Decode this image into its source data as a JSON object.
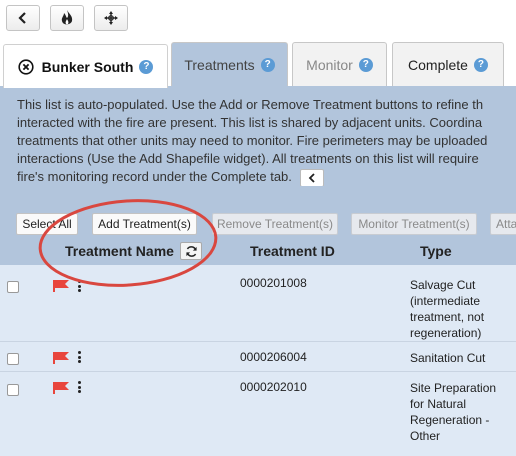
{
  "toolbar": {
    "buttons": [
      {
        "icon": "chevron-left-icon"
      },
      {
        "icon": "fire-icon"
      },
      {
        "icon": "move-crosshair-icon"
      }
    ]
  },
  "tabs": [
    {
      "label": "Bunker South",
      "icon": "close-circle-icon",
      "help": "?",
      "active": true
    },
    {
      "label": "Treatments",
      "help": "?"
    },
    {
      "label": "Monitor",
      "help": "?"
    },
    {
      "label": "Complete",
      "help": "?"
    }
  ],
  "description_lines": [
    "This list is auto-populated. Use the Add or Remove Treatment buttons to refine th",
    "interacted with the fire are present. This list is shared by adjacent units. Coordina",
    "treatments that other units may need to monitor. Fire perimeters may be uploaded",
    "interactions (Use the Add Shapefile widget). All treatments on this list will require",
    "fire's monitoring record under the Complete tab."
  ],
  "actions": {
    "select_all": "Select All",
    "add": "Add Treatment(s)",
    "remove": "Remove Treatment(s)",
    "monitor": "Monitor Treatment(s)",
    "attach": "Atta"
  },
  "table": {
    "headers": {
      "name": "Treatment Name",
      "id": "Treatment ID",
      "type": "Type"
    },
    "rows": [
      {
        "id": "0000201008",
        "type": "Salvage Cut (intermediate treatment, not regeneration)"
      },
      {
        "id": "0000206004",
        "type": "Sanitation Cut"
      },
      {
        "id": "0000202010",
        "type": "Site Preparation for Natural Regeneration - Other"
      }
    ]
  },
  "colors": {
    "panel": "#b2c5dc",
    "rows": "#dfe9f5",
    "flag": "#e8453c",
    "highlight": "#d9473f",
    "help": "#5b9bd5"
  }
}
